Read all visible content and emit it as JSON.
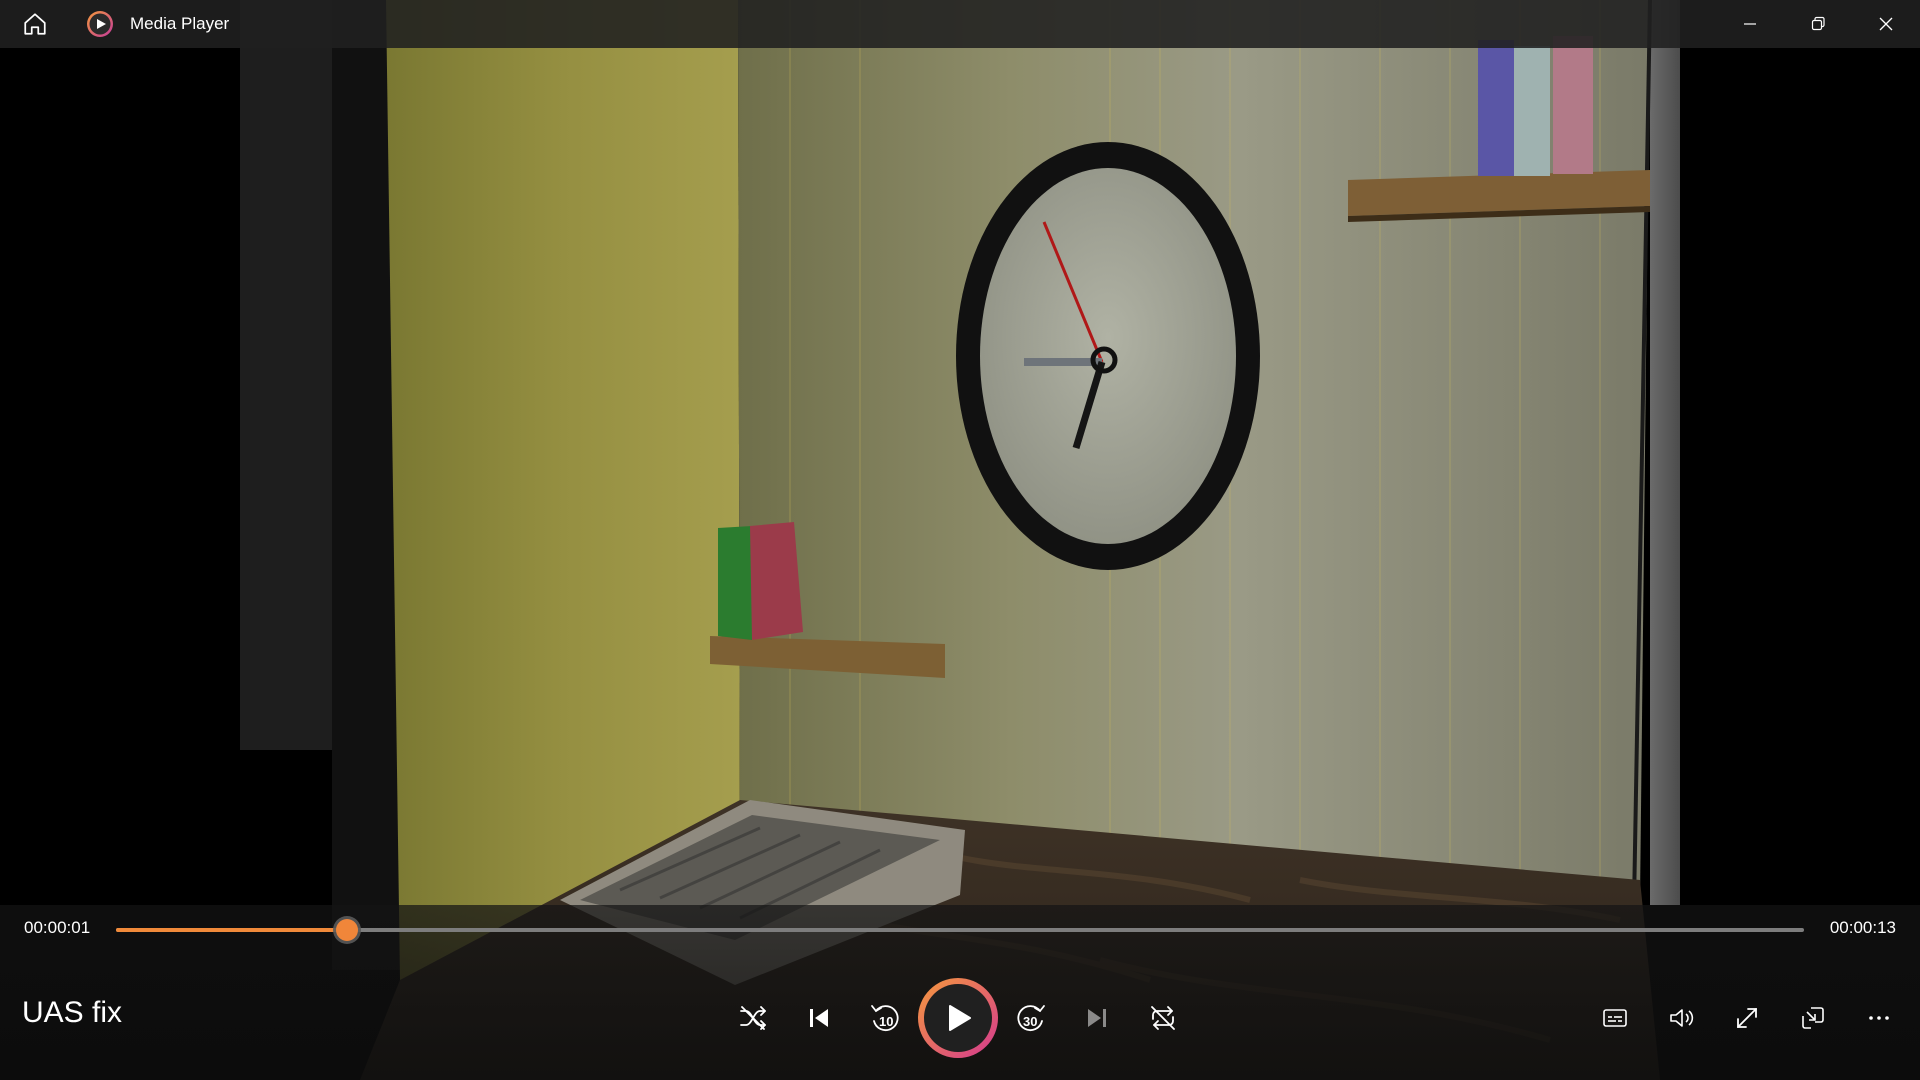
{
  "app": {
    "title": "Media Player"
  },
  "playback": {
    "current_time": "00:00:01",
    "total_time": "00:00:13",
    "progress_percent": 13.7,
    "media_title": "UAS fix"
  },
  "colors": {
    "accent": "#f08a3a",
    "accent2": "#d4398f"
  },
  "icons": {
    "home": "home-icon",
    "app": "media-player-icon",
    "minimize": "minimize-icon",
    "restore": "restore-icon",
    "close": "close-icon",
    "shuffle": "shuffle-icon",
    "previous": "previous-icon",
    "rewind": "rewind-10-icon",
    "play": "play-icon",
    "forward": "forward-30-icon",
    "next": "next-icon",
    "repeat": "repeat-off-icon",
    "captions": "captions-icon",
    "volume": "volume-icon",
    "fullscreen": "fullscreen-icon",
    "miniplayer": "miniplayer-icon",
    "more": "more-icon"
  },
  "skip_labels": {
    "back": "10",
    "forward": "30"
  }
}
